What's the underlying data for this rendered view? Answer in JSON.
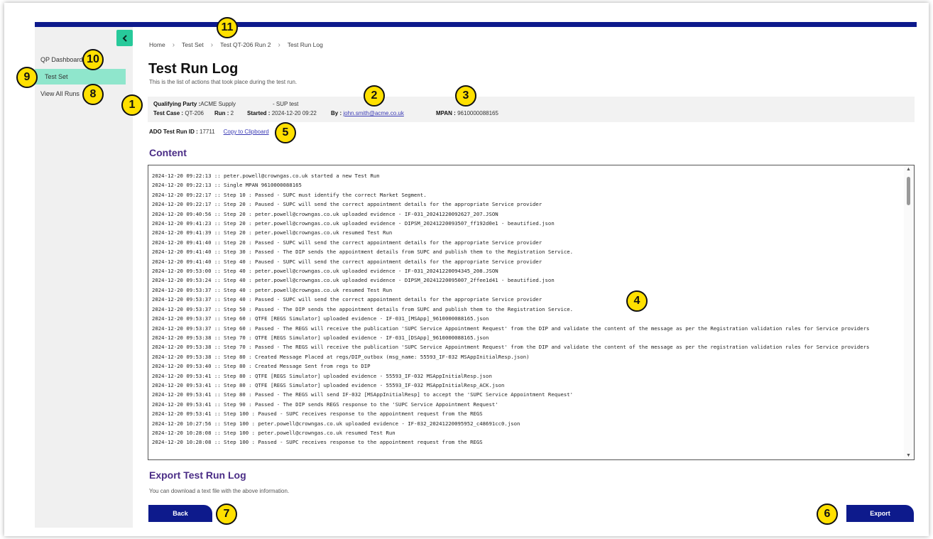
{
  "sidebar": {
    "collapse_icon": "chevron-left-icon",
    "items": [
      {
        "label": "QP Dashboard"
      },
      {
        "label": "Test Set"
      },
      {
        "label": "View All Runs"
      }
    ]
  },
  "breadcrumb": [
    "Home",
    "Test Set",
    "Test QT-206 Run 2",
    "Test Run Log"
  ],
  "page": {
    "title": "Test Run Log",
    "subtitle": "This is the list of actions that took place during the test run."
  },
  "info": {
    "qualifying_party_label": "Qualifying Party :",
    "qualifying_party_value": "ACME Supply",
    "sup_value": "- SUP test",
    "test_case_label": "Test Case :",
    "test_case_value": "QT-206",
    "run_label": "Run :",
    "run_value": "2",
    "started_label": "Started :",
    "started_value": "2024-12-20 09:22",
    "by_label": "By :",
    "by_value": "john.smith@acme.co.uk",
    "mpan_label": "MPAN :",
    "mpan_value": "9610000088165"
  },
  "ado": {
    "label": "ADO Test Run ID :",
    "value": "17711",
    "copy_label": "Copy to Clipboard"
  },
  "content": {
    "title": "Content",
    "log_lines": [
      "2024-12-20 09:22:13 :: peter.powell@crowngas.co.uk started a new Test Run",
      "2024-12-20 09:22:13 :: Single MPAN 9610000088165",
      "2024-12-20 09:22:17 :: Step 10 : Passed - SUPC must identify the correct Market Segment.",
      "2024-12-20 09:22:17 :: Step 20 : Paused - SUPC will send the correct appointment details for the appropriate Service provider",
      "2024-12-20 09:40:56 :: Step 20 : peter.powell@crowngas.co.uk uploaded evidence - IF-031_20241220092627_207.JSON",
      "2024-12-20 09:41:23 :: Step 20 : peter.powell@crowngas.co.uk uploaded evidence - DIPSM_20241220093507_ff192d0e1 - beautified.json",
      "2024-12-20 09:41:39 :: Step 20 : peter.powell@crowngas.co.uk resumed Test Run",
      "2024-12-20 09:41:40 :: Step 20 : Passed - SUPC will send the correct appointment details for the appropriate Service provider",
      "2024-12-20 09:41:40 :: Step 30 : Passed - The DIP sends the appointment details from SUPC and publish them to the Registration Service.",
      "2024-12-20 09:41:40 :: Step 40 : Paused - SUPC will send the correct appointment details for the appropriate Service provider",
      "2024-12-20 09:53:00 :: Step 40 : peter.powell@crowngas.co.uk uploaded evidence - IF-031_20241220094345_208.JSON",
      "2024-12-20 09:53:24 :: Step 40 : peter.powell@crowngas.co.uk uploaded evidence - DIPSM_20241220095007_2ffee1d41 - beautified.json",
      "2024-12-20 09:53:37 :: Step 40 : peter.powell@crowngas.co.uk resumed Test Run",
      "2024-12-20 09:53:37 :: Step 40 : Passed - SUPC will send the correct appointment details for the appropriate Service provider",
      "2024-12-20 09:53:37 :: Step 50 : Passed - The DIP sends the appointment details from SUPC and publish them to the Registration Service.",
      "2024-12-20 09:53:37 :: Step 60 : QTFE [REGS Simulator] uploaded evidence - IF-031_[MSApp]_9610000088165.json",
      "2024-12-20 09:53:37 :: Step 60 : Passed - The REGS will receive the publication 'SUPC Service Appointment Request' from the DIP and validate the content of the message as per the Registration validation rules for Service providers",
      "2024-12-20 09:53:38 :: Step 70 : QTFE [REGS Simulator] uploaded evidence - IF-031_[DSApp]_9610000088165.json",
      "2024-12-20 09:53:38 :: Step 70 : Passed - The REGS will receive the publication 'SUPC Service Appointment Request' from the DIP and validate the content of the message as per the registration validation rules for Service providers",
      "2024-12-20 09:53:38 :: Step 80 : Created Message Placed at regs/DIP_outbox (msg_name: 55593_IF-032 MSAppInitialResp.json)",
      "2024-12-20 09:53:40 :: Step 80 : Created Message Sent from regs to DIP",
      "2024-12-20 09:53:41 :: Step 80 : QTFE [REGS Simulator] uploaded evidence - 55593_IF-032 MSAppInitialResp.json",
      "2024-12-20 09:53:41 :: Step 80 : QTFE [REGS Simulator] uploaded evidence - 55593_IF-032 MSAppInitialResp_ACK.json",
      "2024-12-20 09:53:41 :: Step 80 : Passed - The REGS will send IF-032 [MSAppInitialResp] to accept the 'SUPC Service Appointment Request'",
      "2024-12-20 09:53:41 :: Step 90 : Passed - The DIP sends REGS response to the 'SUPC Service Appointment Request'",
      "2024-12-20 09:53:41 :: Step 100 : Paused - SUPC receives response to the appointment request from the REGS",
      "2024-12-20 10:27:56 :: Step 100 : peter.powell@crowngas.co.uk uploaded evidence - IF-032_20241220095952_c48691cc0.json",
      "2024-12-20 10:28:08 :: Step 100 : peter.powell@crowngas.co.uk resumed Test Run",
      "2024-12-20 10:28:08 :: Step 100 : Passed - SUPC receives response to the appointment request from the REGS"
    ]
  },
  "export": {
    "title": "Export Test Run Log",
    "subtitle": "You can download a text file with the above information.",
    "back_label": "Back",
    "export_label": "Export"
  },
  "badges": [
    "1",
    "2",
    "3",
    "4",
    "5",
    "6",
    "7",
    "8",
    "9",
    "10",
    "11"
  ],
  "colors": {
    "nav_bar": "#0d1a8c",
    "accent_green": "#27c99a",
    "active_nav": "#8fe6cc",
    "heading_purple": "#4a2c86",
    "badge_yellow": "#ffe000"
  }
}
